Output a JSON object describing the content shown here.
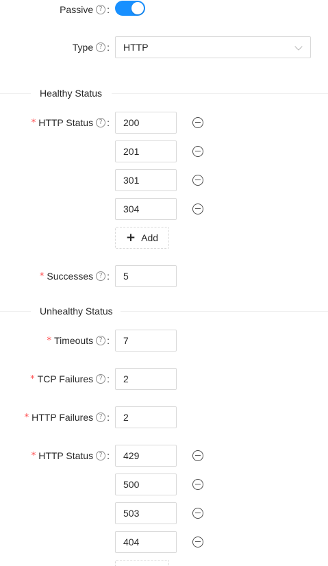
{
  "passive": {
    "label": "Passive",
    "help": "?",
    "checked": true,
    "accent": "#1890ff"
  },
  "type": {
    "label": "Type",
    "help": "?",
    "value": "HTTP"
  },
  "healthy": {
    "title": "Healthy Status",
    "http_status_label": "HTTP Status",
    "statuses": [
      "200",
      "201",
      "301",
      "304"
    ],
    "add_label": "Add",
    "successes_label": "Successes",
    "successes_value": "5"
  },
  "unhealthy": {
    "title": "Unhealthy Status",
    "timeouts_label": "Timeouts",
    "timeouts_value": "7",
    "tcp_failures_label": "TCP Failures",
    "tcp_failures_value": "2",
    "http_failures_label": "HTTP Failures",
    "http_failures_value": "2",
    "http_status_label": "HTTP Status",
    "statuses": [
      "429",
      "500",
      "503",
      "404"
    ]
  },
  "common": {
    "required_mark": "*",
    "colon": ":",
    "help_mark": "?"
  }
}
